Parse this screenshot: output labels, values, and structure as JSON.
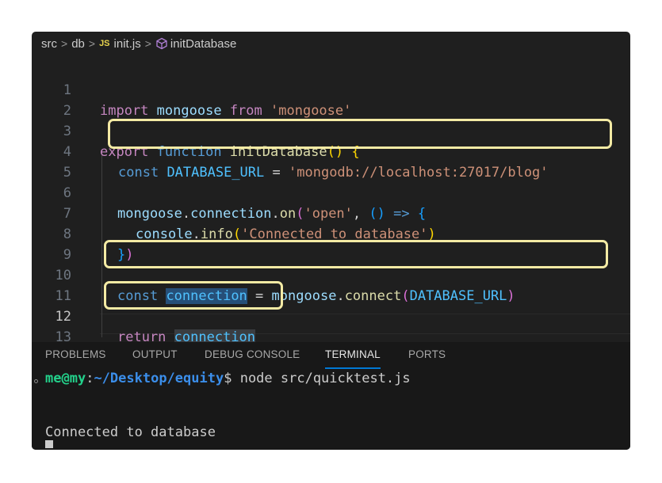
{
  "breadcrumb": {
    "items": [
      "src",
      "db",
      "init.js",
      "initDatabase"
    ],
    "file_badge": "JS",
    "separator": ">"
  },
  "editor": {
    "active_line": 12,
    "line_numbers": [
      "1",
      "2",
      "3",
      "4",
      "5",
      "6",
      "7",
      "8",
      "9",
      "10",
      "11",
      "12",
      "13"
    ],
    "line1": {
      "import": "import",
      "mongoose": "mongoose",
      "from": "from",
      "module": "'mongoose'"
    },
    "line3": {
      "export": "export",
      "function": "function",
      "name": "initDatabase",
      "paren_open": "(",
      "paren_close": ")",
      "brace_open": "{"
    },
    "line4": {
      "const": "const",
      "name": "DATABASE_URL",
      "eq": "=",
      "value": "'mongodb://localhost:27017/blog'"
    },
    "line6": {
      "obj": "mongoose",
      "dot1": ".",
      "prop": "connection",
      "dot2": ".",
      "method": "on",
      "paren": "(",
      "event": "'open'",
      "comma": ",",
      "arrow_paren": "()",
      "arrow": "=>",
      "brace": "{"
    },
    "line7": {
      "obj": "console",
      "dot": ".",
      "method": "info",
      "paren_open": "(",
      "msg": "'Connected to database'",
      "paren_close": ")"
    },
    "line8": {
      "brace": "}",
      "paren": ")"
    },
    "line10": {
      "const": "const",
      "name": "connection",
      "eq": "=",
      "obj": "mongoose",
      "dot": ".",
      "method": "connect",
      "paren_open": "(",
      "arg": "DATABASE_URL",
      "paren_close": ")"
    },
    "line12": {
      "return": "return",
      "name": "connection"
    },
    "line13": {
      "brace": "}"
    }
  },
  "panel": {
    "tabs": [
      "PROBLEMS",
      "OUTPUT",
      "DEBUG CONSOLE",
      "TERMINAL",
      "PORTS"
    ],
    "active_tab": "TERMINAL"
  },
  "terminal": {
    "user": "me@my",
    "path_sep": ":",
    "path": "~/Desktop/equity",
    "prompt_end": "$",
    "command": "node src/quicktest.js",
    "output": "Connected to database"
  },
  "colors": {
    "editor_bg": "#1f1f1f",
    "panel_bg": "#181818",
    "highlight_box": "#f3eaa4",
    "keyword": "#569cd6",
    "string": "#ce9178",
    "terminal_user": "#23d18b",
    "terminal_path": "#3b8eea"
  }
}
